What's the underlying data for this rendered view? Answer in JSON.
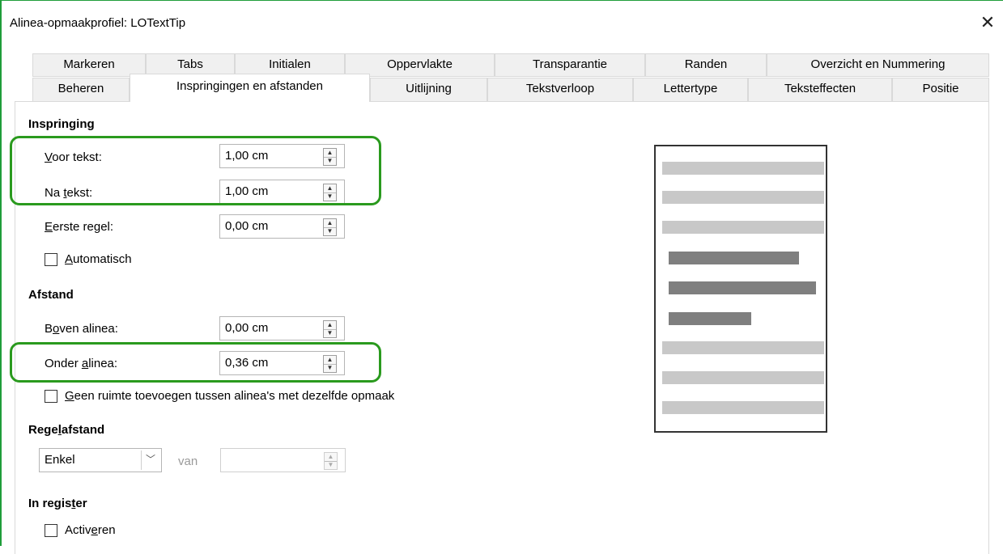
{
  "window": {
    "title": "Alinea-opmaakprofiel: LOTextTip",
    "close_glyph": "✕"
  },
  "tabs_row1": [
    "Markeren",
    "Tabs",
    "Initialen",
    "Oppervlakte",
    "Transparantie",
    "Randen",
    "Overzicht en Nummering"
  ],
  "tabs_row2": [
    "Beheren",
    "Inspringingen en afstanden",
    "Uitlijning",
    "Tekstverloop",
    "Lettertype",
    "Teksteffecten",
    "Positie"
  ],
  "active_tab": "Inspringingen en afstanden",
  "indent": {
    "heading": "Inspringing",
    "voor_label": "Voor tekst:",
    "voor_value": "1,00 cm",
    "na_label": "Na tekst:",
    "na_value": "1,00 cm",
    "eerste_label": "Eerste regel:",
    "eerste_value": "0,00 cm",
    "auto_label": "Automatisch"
  },
  "spacing": {
    "heading": "Afstand",
    "boven_label": "Boven alinea:",
    "boven_value": "0,00 cm",
    "onder_label": "Onder alinea:",
    "onder_value": "0,36 cm",
    "geen_label": "Geen ruimte toevoegen tussen alinea's met dezelfde opmaak"
  },
  "linespacing": {
    "heading": "Regelafstand",
    "selected": "Enkel",
    "van_label": "van",
    "value": ""
  },
  "register": {
    "heading": "In register",
    "activate_label": "Activeren"
  },
  "colors": {
    "highlight": "#2a9a1e",
    "preview_light": "#c8c8c8",
    "preview_dark": "#7f7f7f"
  },
  "icons": {
    "close": "close-icon",
    "spin": "spin-arrows-icon",
    "dropdown": "chevron-down-icon"
  }
}
